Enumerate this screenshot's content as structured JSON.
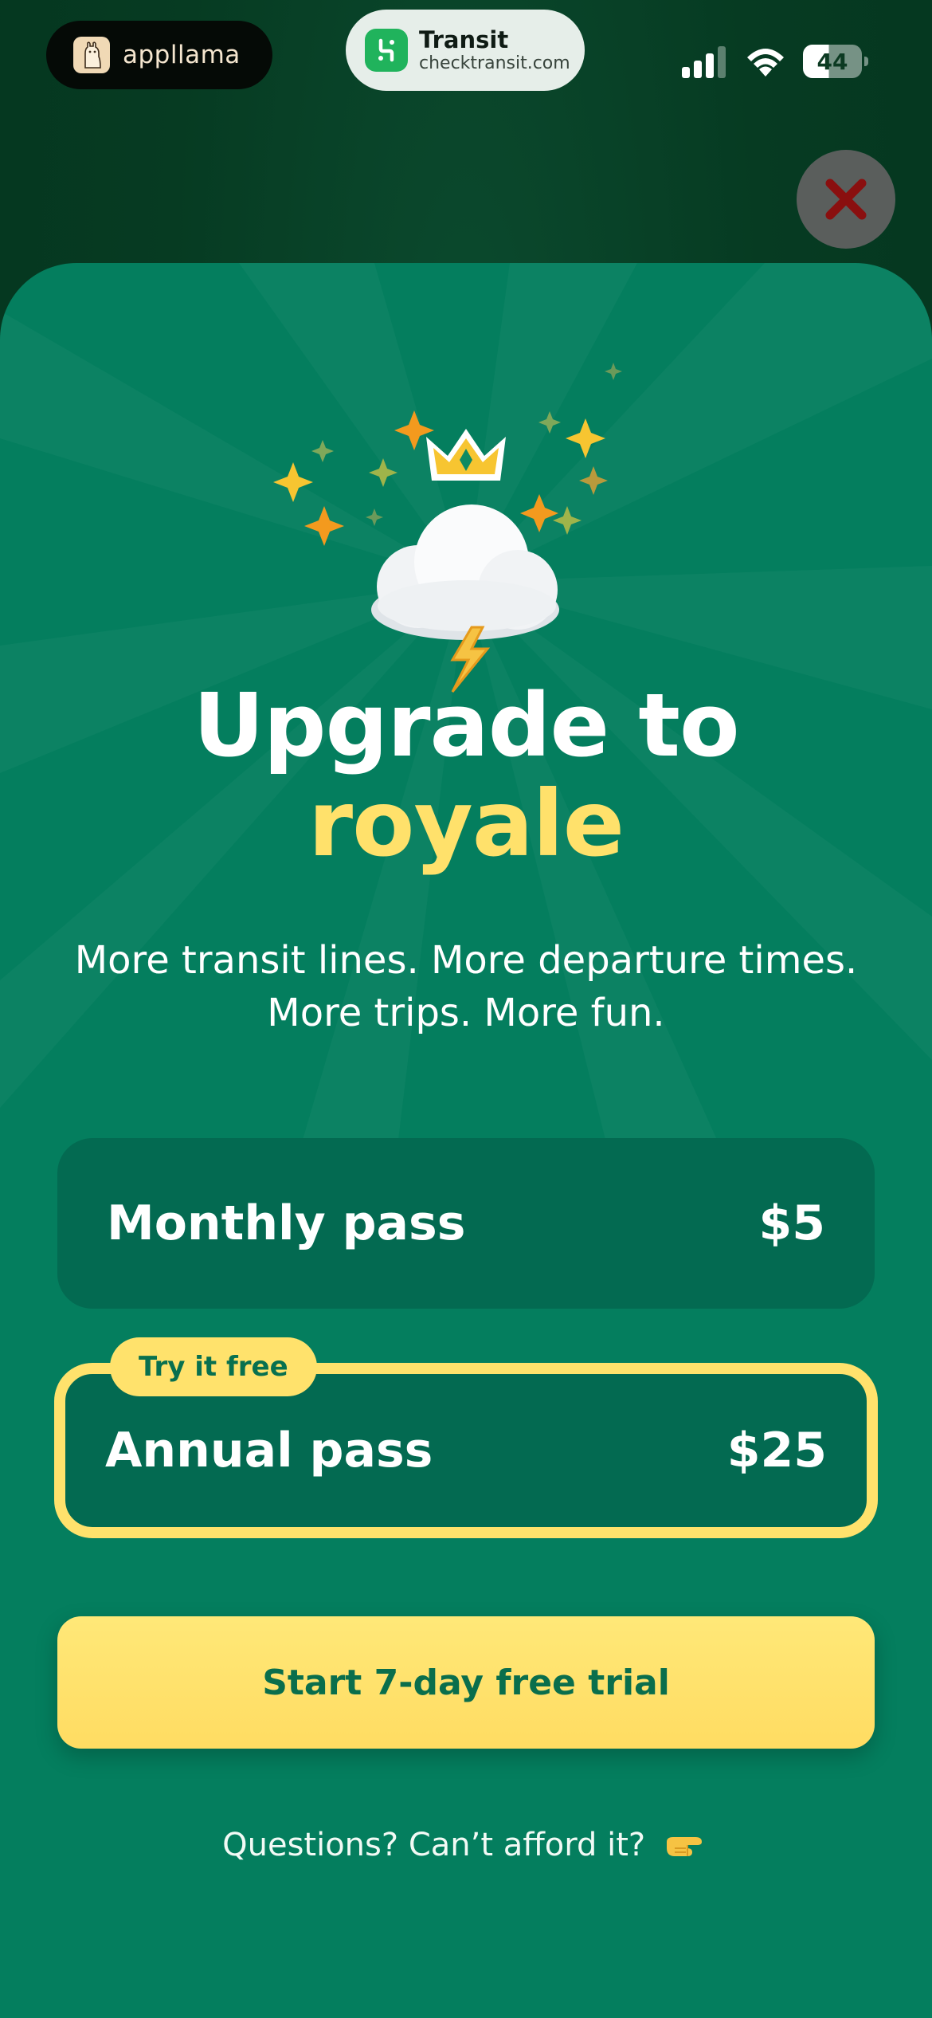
{
  "status_bar": {
    "app_pill": {
      "name": "appllama",
      "icon": "llama-logo-icon"
    },
    "transit_pill": {
      "title": "Transit",
      "url": "checktransit.com",
      "icon": "transit-logo-icon"
    },
    "battery_level": "44",
    "signal_icon": "cellular-signal-icon",
    "wifi_icon": "wifi-icon"
  },
  "close_button": {
    "icon": "close-x-icon",
    "color": "#8a0f0f"
  },
  "hero": {
    "crown_icon": "crown-icon",
    "cloud_icon": "storm-cloud-icon",
    "sparkles_icon": "sparkles-icon"
  },
  "headline": {
    "line1": "Upgrade to",
    "line2": "royale"
  },
  "subtitle": {
    "line1": "More transit lines. More departure times.",
    "line2": "More trips. More fun."
  },
  "plans": [
    {
      "name": "Monthly pass",
      "price": "$5",
      "selected": false
    },
    {
      "name": "Annual pass",
      "price": "$25",
      "selected": true,
      "badge": "Try it free"
    }
  ],
  "cta": {
    "label": "Start 7-day free trial"
  },
  "help": {
    "label": "Questions? Can’t afford it?",
    "icon": "pointing-hand-icon"
  },
  "colors": {
    "sheet": "#047e5e",
    "plan_card": "#036a51",
    "accent_yellow": "#ffe26c",
    "cta_text": "#0a6e4c"
  }
}
